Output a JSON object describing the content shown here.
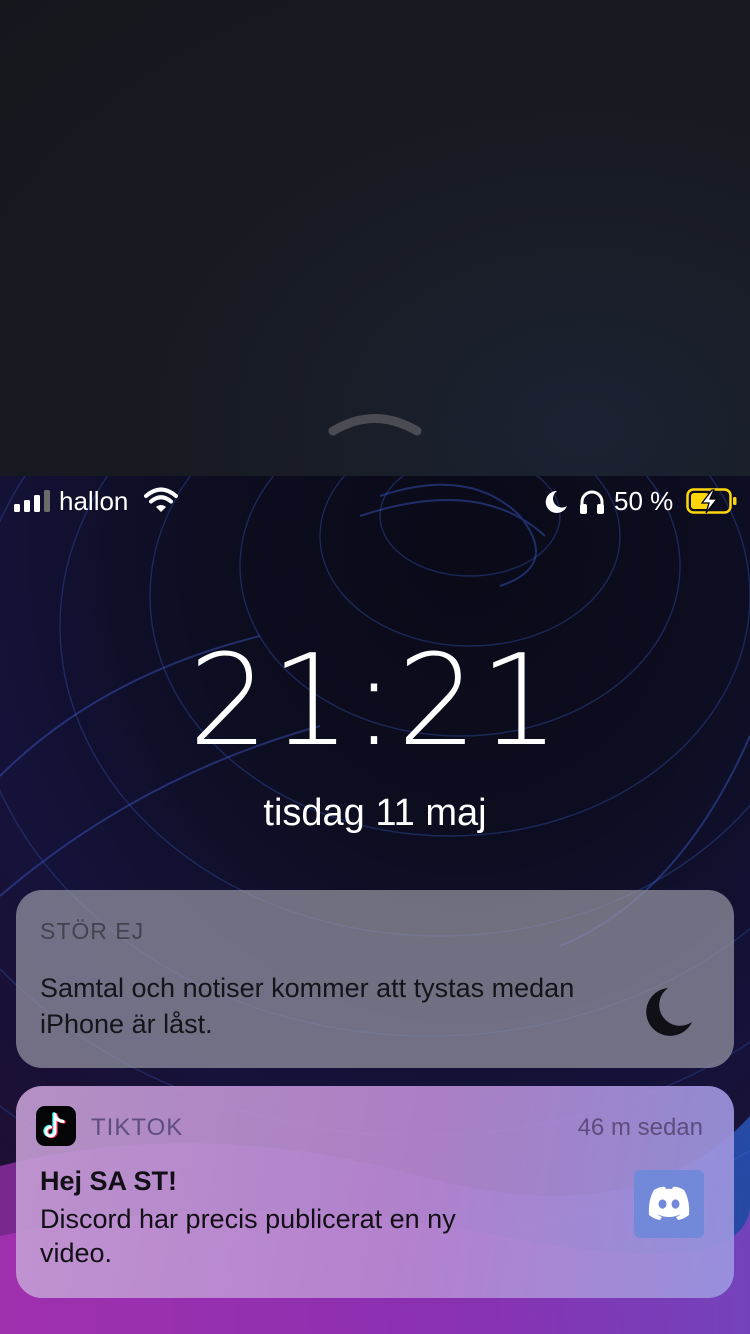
{
  "status_bar": {
    "carrier": "hallon",
    "battery_percent": "50 %",
    "icons": [
      "signal-icon",
      "wifi-icon",
      "moon-icon",
      "headphones-icon",
      "battery-charging-icon"
    ],
    "battery_level": 0.5,
    "battery_color": "#ffd60a"
  },
  "lock_screen": {
    "time": "21:21",
    "date": "tisdag 11 maj"
  },
  "notifications": [
    {
      "type": "do-not-disturb",
      "title": "STÖR EJ",
      "body": "Samtal och notiser kommer att tystas medan iPhone är låst.",
      "icon": "moon-icon"
    },
    {
      "app": "TIKTOK",
      "app_icon": "tiktok-icon",
      "time_ago": "46 m sedan",
      "title": "Hej SA ST!",
      "body": "Discord har precis publicerat en ny video.",
      "thumbnail": "discord-logo-icon",
      "thumbnail_color": "#7289da"
    }
  ]
}
